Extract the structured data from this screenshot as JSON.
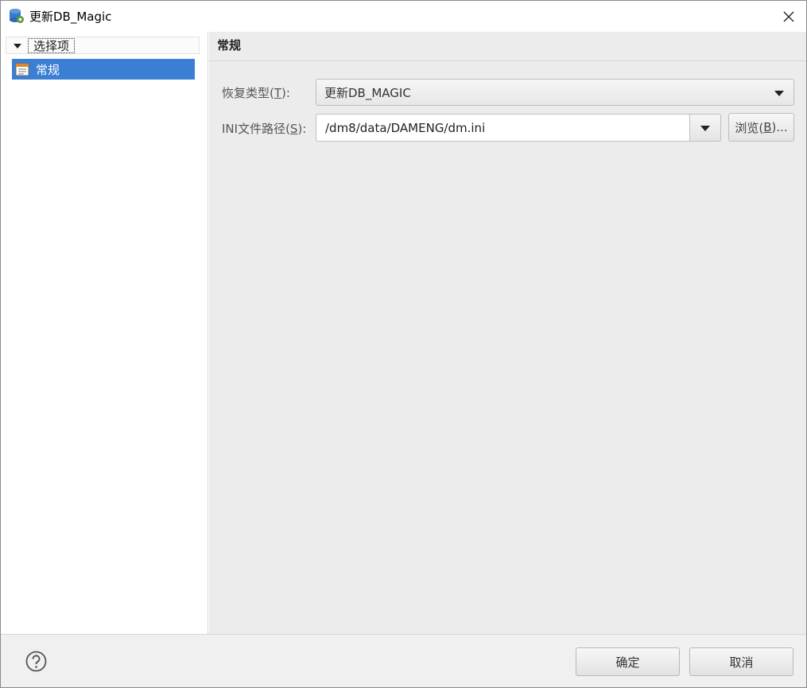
{
  "window": {
    "title": "更新DB_Magic",
    "icon": "database-gear-icon",
    "close_icon": "close-icon"
  },
  "tree": {
    "root_label": "选择项",
    "items": [
      {
        "label": "常规",
        "icon": "properties-page-icon",
        "selected": true
      }
    ]
  },
  "page": {
    "title": "常规",
    "restore_type": {
      "label_prefix": "恢复类型(",
      "label_mnemonic": "T",
      "label_suffix": "):",
      "value": "更新DB_MAGIC"
    },
    "ini_path": {
      "label_prefix": "INI文件路径(",
      "label_mnemonic": "S",
      "label_suffix": "):",
      "value": "/dm8/data/DAMENG/dm.ini"
    },
    "browse": {
      "label_prefix": "浏览(",
      "label_mnemonic": "B",
      "label_suffix": ")..."
    }
  },
  "footer": {
    "help_icon": "help-icon",
    "ok_label": "确定",
    "cancel_label": "取消"
  },
  "colors": {
    "selection": "#3b7fd5",
    "content_bg": "#ececec"
  }
}
